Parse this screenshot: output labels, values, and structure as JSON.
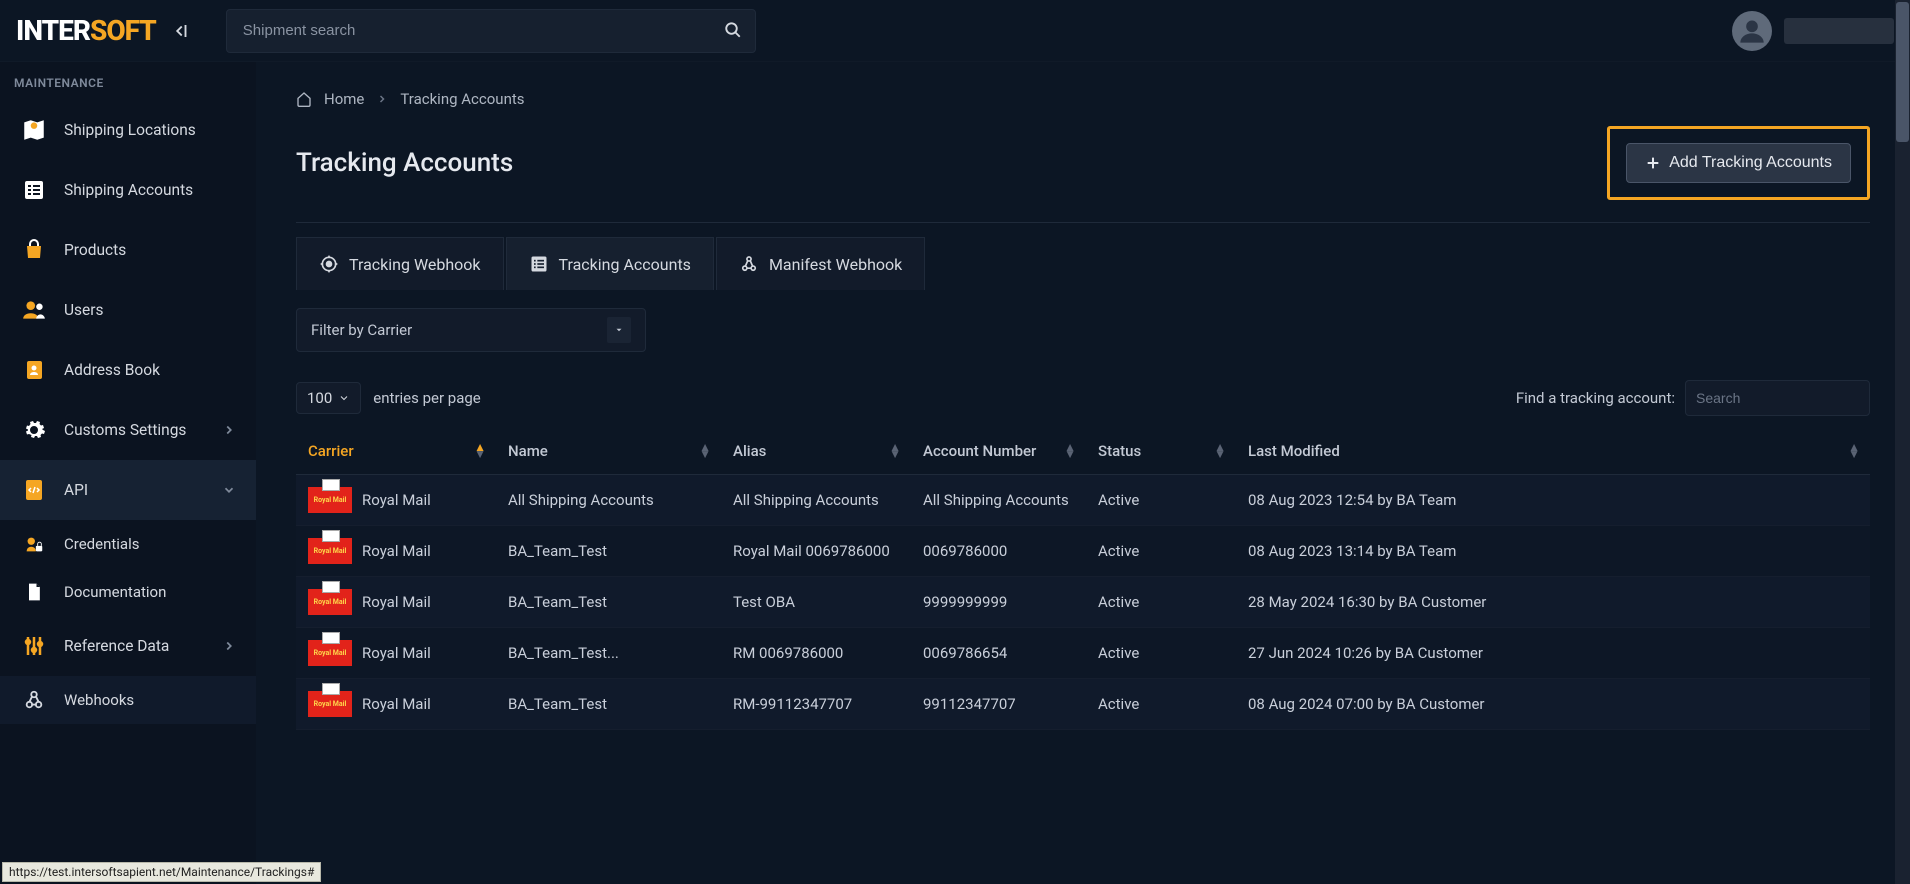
{
  "logo": {
    "part1": "INTER",
    "part2": "SOFT"
  },
  "search": {
    "placeholder": "Shipment search"
  },
  "sidebar": {
    "section": "MAINTENANCE",
    "items": [
      {
        "label": "Shipping Locations"
      },
      {
        "label": "Shipping Accounts"
      },
      {
        "label": "Products"
      },
      {
        "label": "Users"
      },
      {
        "label": "Address Book"
      },
      {
        "label": "Customs Settings",
        "hasSub": true
      },
      {
        "label": "API",
        "hasSub": true,
        "expanded": true
      },
      {
        "label": "Credentials",
        "sub": true
      },
      {
        "label": "Documentation",
        "sub": true
      },
      {
        "label": "Reference Data",
        "hasSub": true
      },
      {
        "label": "Webhooks",
        "sub": true,
        "selected": true
      }
    ]
  },
  "breadcrumb": {
    "home": "Home",
    "current": "Tracking Accounts"
  },
  "page": {
    "title": "Tracking Accounts",
    "addBtn": "Add Tracking Accounts"
  },
  "tabs": [
    {
      "label": "Tracking Webhook"
    },
    {
      "label": "Tracking Accounts",
      "active": true
    },
    {
      "label": "Manifest Webhook"
    }
  ],
  "filter": {
    "label": "Filter by Carrier"
  },
  "tableControls": {
    "pageSize": "100",
    "entriesLabel": "entries per page",
    "findLabel": "Find a tracking account:",
    "searchPlaceholder": "Search"
  },
  "columns": [
    "Carrier",
    "Name",
    "Alias",
    "Account Number",
    "Status",
    "Last Modified"
  ],
  "rows": [
    {
      "carrier": "Royal Mail",
      "name": "All Shipping Accounts",
      "alias": "All Shipping Accounts",
      "account": "All Shipping Accounts",
      "status": "Active",
      "modified": "08 Aug 2023 12:54 by BA Team"
    },
    {
      "carrier": "Royal Mail",
      "name": "BA_Team_Test",
      "alias": "Royal Mail 0069786000",
      "account": "0069786000",
      "status": "Active",
      "modified": "08 Aug 2023 13:14 by BA Team"
    },
    {
      "carrier": "Royal Mail",
      "name": "BA_Team_Test",
      "alias": "Test OBA",
      "account": "9999999999",
      "status": "Active",
      "modified": "28 May 2024 16:30 by BA Customer"
    },
    {
      "carrier": "Royal Mail",
      "name": "BA_Team_Test...",
      "alias": "RM 0069786000",
      "account": "0069786654",
      "status": "Active",
      "modified": "27 Jun 2024 10:26 by BA Customer"
    },
    {
      "carrier": "Royal Mail",
      "name": "BA_Team_Test",
      "alias": "RM-99112347707",
      "account": "99112347707",
      "status": "Active",
      "modified": "08 Aug 2024 07:00 by BA Customer"
    }
  ],
  "statusBar": "https://test.intersoftsapient.net/Maintenance/Trackings#"
}
